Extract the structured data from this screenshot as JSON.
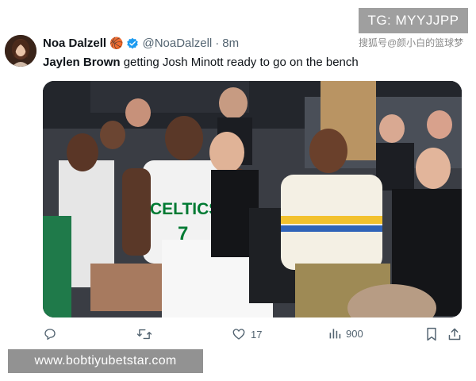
{
  "tweet": {
    "author": {
      "display_name": "Noa Dalzell",
      "emoji": "🏀",
      "handle": "@NoaDalzell",
      "separator": "·",
      "time": "8m"
    },
    "text_bold": "Jaylen Brown",
    "text_rest": " getting Josh Minott ready to go on the bench",
    "media": {
      "jersey_text": "CELTICS",
      "jersey_number": "7"
    },
    "actions": {
      "reply_count": "",
      "retweet_count": "",
      "like_count": "17",
      "views_count": "900"
    }
  },
  "watermarks": {
    "tg": "TG: MYYJJPP",
    "sohu": "搜狐号@颜小白的篮球梦",
    "url": "www.bobtiyubetstar.com"
  },
  "colors": {
    "text_primary": "#0f1419",
    "text_secondary": "#536471",
    "verified_blue": "#1d9bf0",
    "celtics_green": "#007a33"
  }
}
